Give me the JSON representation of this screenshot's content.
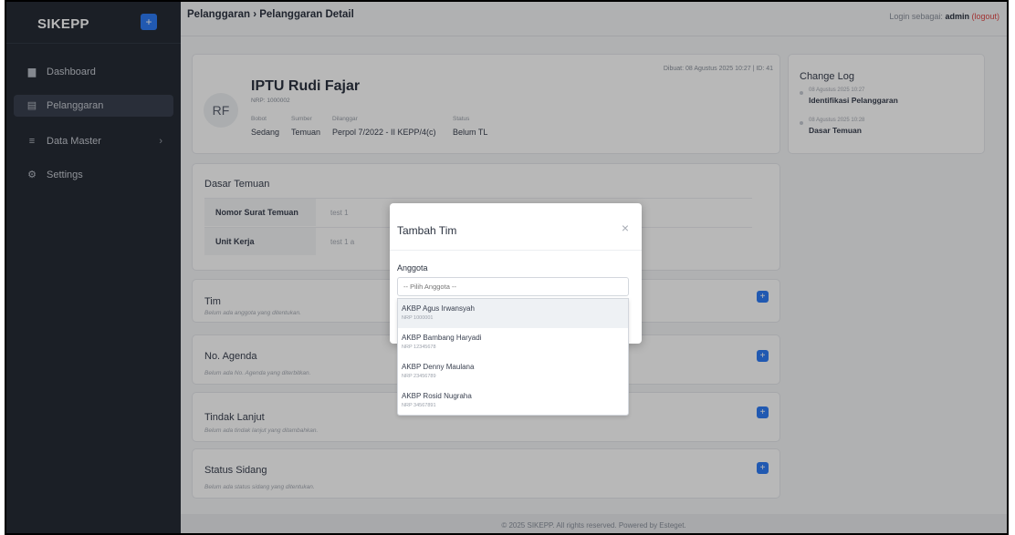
{
  "sidebar": {
    "brand": "SIKEPP",
    "add_icon": "+",
    "items": [
      {
        "label": "Dashboard",
        "icon": "chart-bar-icon",
        "glyph": "▆"
      },
      {
        "label": "Pelanggaran",
        "icon": "document-icon",
        "glyph": "▤"
      },
      {
        "label": "Data Master",
        "icon": "menu-icon",
        "glyph": "≡",
        "chevron": "›"
      },
      {
        "label": "Settings",
        "icon": "gear-icon",
        "glyph": "⚙"
      }
    ]
  },
  "header": {
    "breadcrumb": "Pelanggaran › Pelanggaran Detail",
    "login_prefix": "Login sebagai:",
    "login_user": "admin",
    "logout": "(logout)"
  },
  "profile": {
    "initials": "RF",
    "name": "IPTU Rudi Fajar",
    "nrp": "NRP: 1000002",
    "created": "Dibuat: 08 Agustus 2025 10:27 | ID: 41",
    "meta": [
      {
        "label": "Bobot",
        "value": "Sedang"
      },
      {
        "label": "Sumber",
        "value": "Temuan"
      },
      {
        "label": "Dilanggar",
        "value": "Perpol 7/2022 - II KEPP/4(c)"
      },
      {
        "label": "Status",
        "value": "Belum TL"
      }
    ]
  },
  "changelog": {
    "title": "Change Log",
    "entries": [
      {
        "date": "08 Agustus 2025 10:27",
        "text": "Identifikasi Pelanggaran"
      },
      {
        "date": "08 Agustus 2025 10:28",
        "text": "Dasar Temuan"
      }
    ]
  },
  "dasar_temuan": {
    "title": "Dasar Temuan",
    "rows": [
      {
        "key": "Nomor Surat Temuan",
        "value": "test 1"
      },
      {
        "key": "Unit Kerja",
        "value": "test 1 a"
      }
    ]
  },
  "sections": [
    {
      "title": "Tim",
      "subtitle": "Belum ada anggota yang ditentukan."
    },
    {
      "title": "No. Agenda",
      "subtitle": "Belum ada No. Agenda yang diterbitkan."
    },
    {
      "title": "Tindak Lanjut",
      "subtitle": "Belum ada tindak lanjut yang ditambahkan."
    },
    {
      "title": "Status Sidang",
      "subtitle": "Belum ada status sidang yang ditentukan."
    }
  ],
  "footer": "© 2025 SIKEPP. All rights reserved. Powered by Esteget.",
  "modal": {
    "title": "Tambah Tim",
    "close": "×",
    "field_label": "Anggota",
    "placeholder": "-- Pilih Anggota --",
    "options": [
      {
        "name": "AKBP Agus Irwansyah",
        "nrp": "NRP 1000001"
      },
      {
        "name": "AKBP Bambang Haryadi",
        "nrp": "NRP 12345678"
      },
      {
        "name": "AKBP Denny Maulana",
        "nrp": "NRP 23456789"
      },
      {
        "name": "AKBP Rosid Nugraha",
        "nrp": "NRP 34567891"
      }
    ]
  },
  "colors": {
    "sidebar_bg": "#262b35",
    "accent": "#2f7cf6",
    "logout": "#e04848"
  }
}
